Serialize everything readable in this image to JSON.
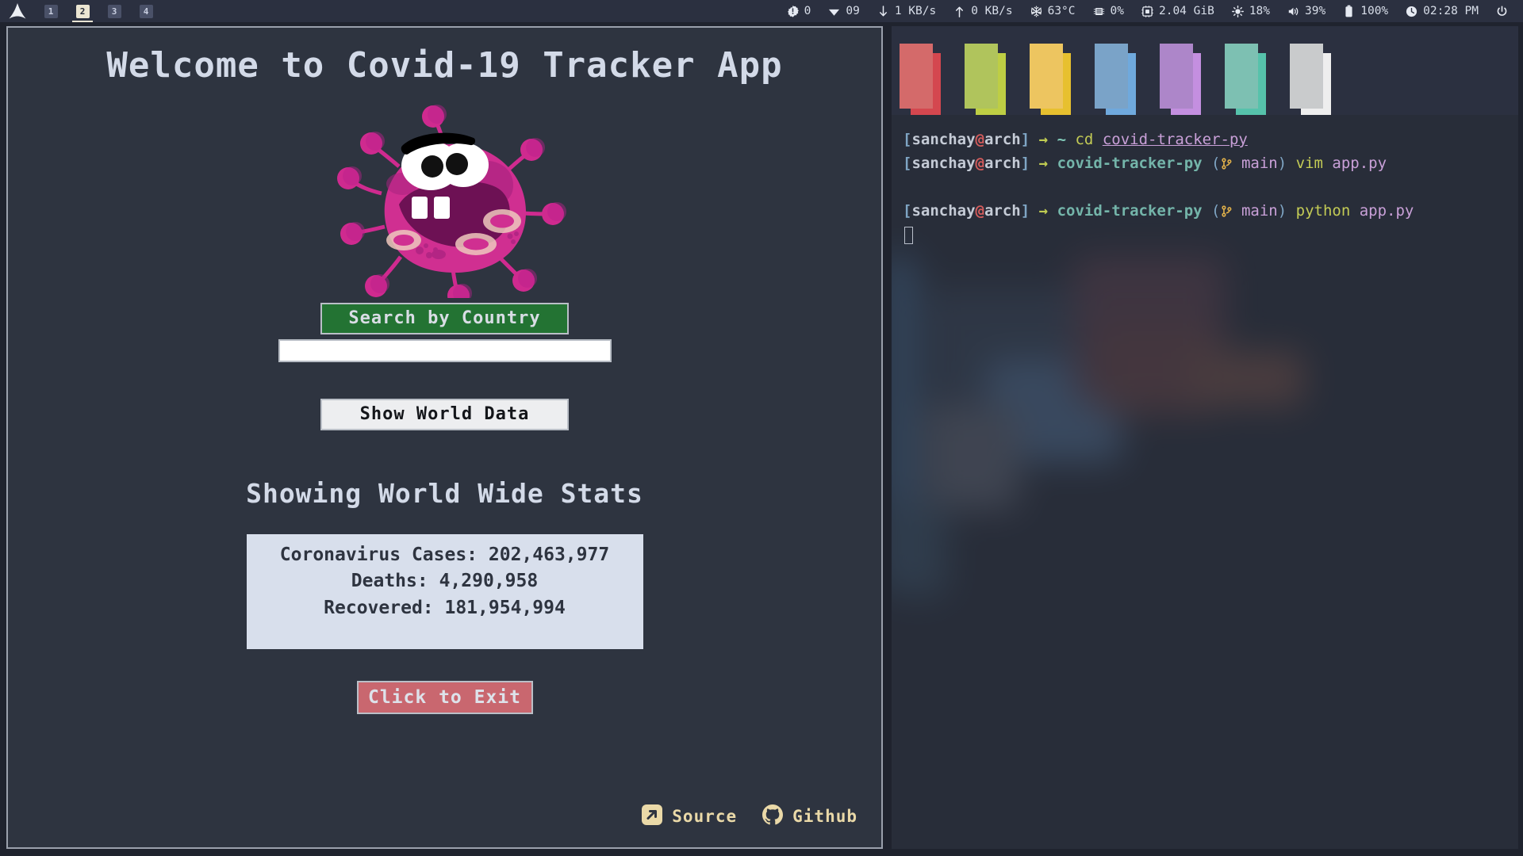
{
  "topbar": {
    "logo_icon": "arch-logo-icon",
    "workspaces": [
      {
        "label": "1",
        "active": false
      },
      {
        "label": "2",
        "active": true
      },
      {
        "label": "3",
        "active": false
      },
      {
        "label": "4",
        "active": false
      }
    ],
    "status_items": [
      {
        "icon": "alert-badge-icon",
        "value": "0"
      },
      {
        "icon": "wifi-icon",
        "value": "09"
      },
      {
        "icon": "download-arrow-icon",
        "value": "1 KB/s"
      },
      {
        "icon": "upload-arrow-icon",
        "value": "0 KB/s"
      },
      {
        "icon": "snowflake-temperature-icon",
        "value": "63°C"
      },
      {
        "icon": "cpu-chip-icon",
        "value": "0%"
      },
      {
        "icon": "memory-icon",
        "value": "2.04 GiB"
      },
      {
        "icon": "brightness-icon",
        "value": "18%"
      },
      {
        "icon": "volume-icon",
        "value": "39%"
      },
      {
        "icon": "battery-icon",
        "value": "100%"
      },
      {
        "icon": "clock-icon",
        "value": "02:28 PM"
      },
      {
        "icon": "power-icon",
        "value": ""
      }
    ]
  },
  "app": {
    "title": "Welcome to Covid-19 Tracker App",
    "mascot_icon": "coronavirus-mascot-icon",
    "search_button": "Search by Country",
    "country_input_value": "",
    "country_input_placeholder": "",
    "world_button": "Show World Data",
    "stats_heading": "Showing World Wide Stats",
    "stats": [
      "Coronavirus Cases: 202,463,977",
      "Deaths: 4,290,958",
      "Recovered: 181,954,994"
    ],
    "exit_button": "Click to Exit",
    "footer": [
      {
        "icon": "external-link-icon",
        "label": "Source"
      },
      {
        "icon": "github-icon",
        "label": "Github"
      }
    ],
    "colors": {
      "window_bg": "#2e3440",
      "search_btn": "#237333",
      "world_btn": "#edeef0",
      "exit_btn": "#c9676f",
      "stats_bg": "#d8dfec",
      "link_text": "#ead9a8"
    }
  },
  "terminal": {
    "swatches": [
      {
        "front": "#d46a6a",
        "back": "#d4474f"
      },
      {
        "front": "#b0c45c",
        "back": "#bece44"
      },
      {
        "front": "#edc560",
        "back": "#e7c02f"
      },
      {
        "front": "#7aa3c8",
        "back": "#6fa9dd"
      },
      {
        "front": "#ad86c9",
        "back": "#c48fe0"
      },
      {
        "front": "#7dc0b2",
        "back": "#56c2ab"
      },
      {
        "front": "#c9cbcc",
        "back": "#eeeeee"
      }
    ],
    "lines": [
      {
        "prompt_open": "[",
        "user": "sanchay",
        "at": "@",
        "host": "arch",
        "prompt_close": "]",
        "arrow": "→",
        "cwd": "~",
        "cwd_style": "tilde",
        "git": null,
        "command": "cd",
        "arg": "covid-tracker-py",
        "arg_style": "path"
      },
      {
        "prompt_open": "[",
        "user": "sanchay",
        "at": "@",
        "host": "arch",
        "prompt_close": "]",
        "arrow": "→",
        "cwd": "covid-tracker-py",
        "cwd_style": "dir",
        "git": {
          "icon": "git-branch-icon",
          "branch": "main",
          "open": "(",
          "close": ")"
        },
        "command": "vim",
        "arg": "app.py",
        "arg_style": "arg"
      },
      {
        "prompt_open": "[",
        "user": "sanchay",
        "at": "@",
        "host": "arch",
        "prompt_close": "]",
        "arrow": "→",
        "cwd": "covid-tracker-py",
        "cwd_style": "dir",
        "git": {
          "icon": "git-branch-icon",
          "branch": "main",
          "open": "(",
          "close": ")"
        },
        "command": "python",
        "arg": "app.py",
        "arg_style": "arg"
      }
    ]
  }
}
